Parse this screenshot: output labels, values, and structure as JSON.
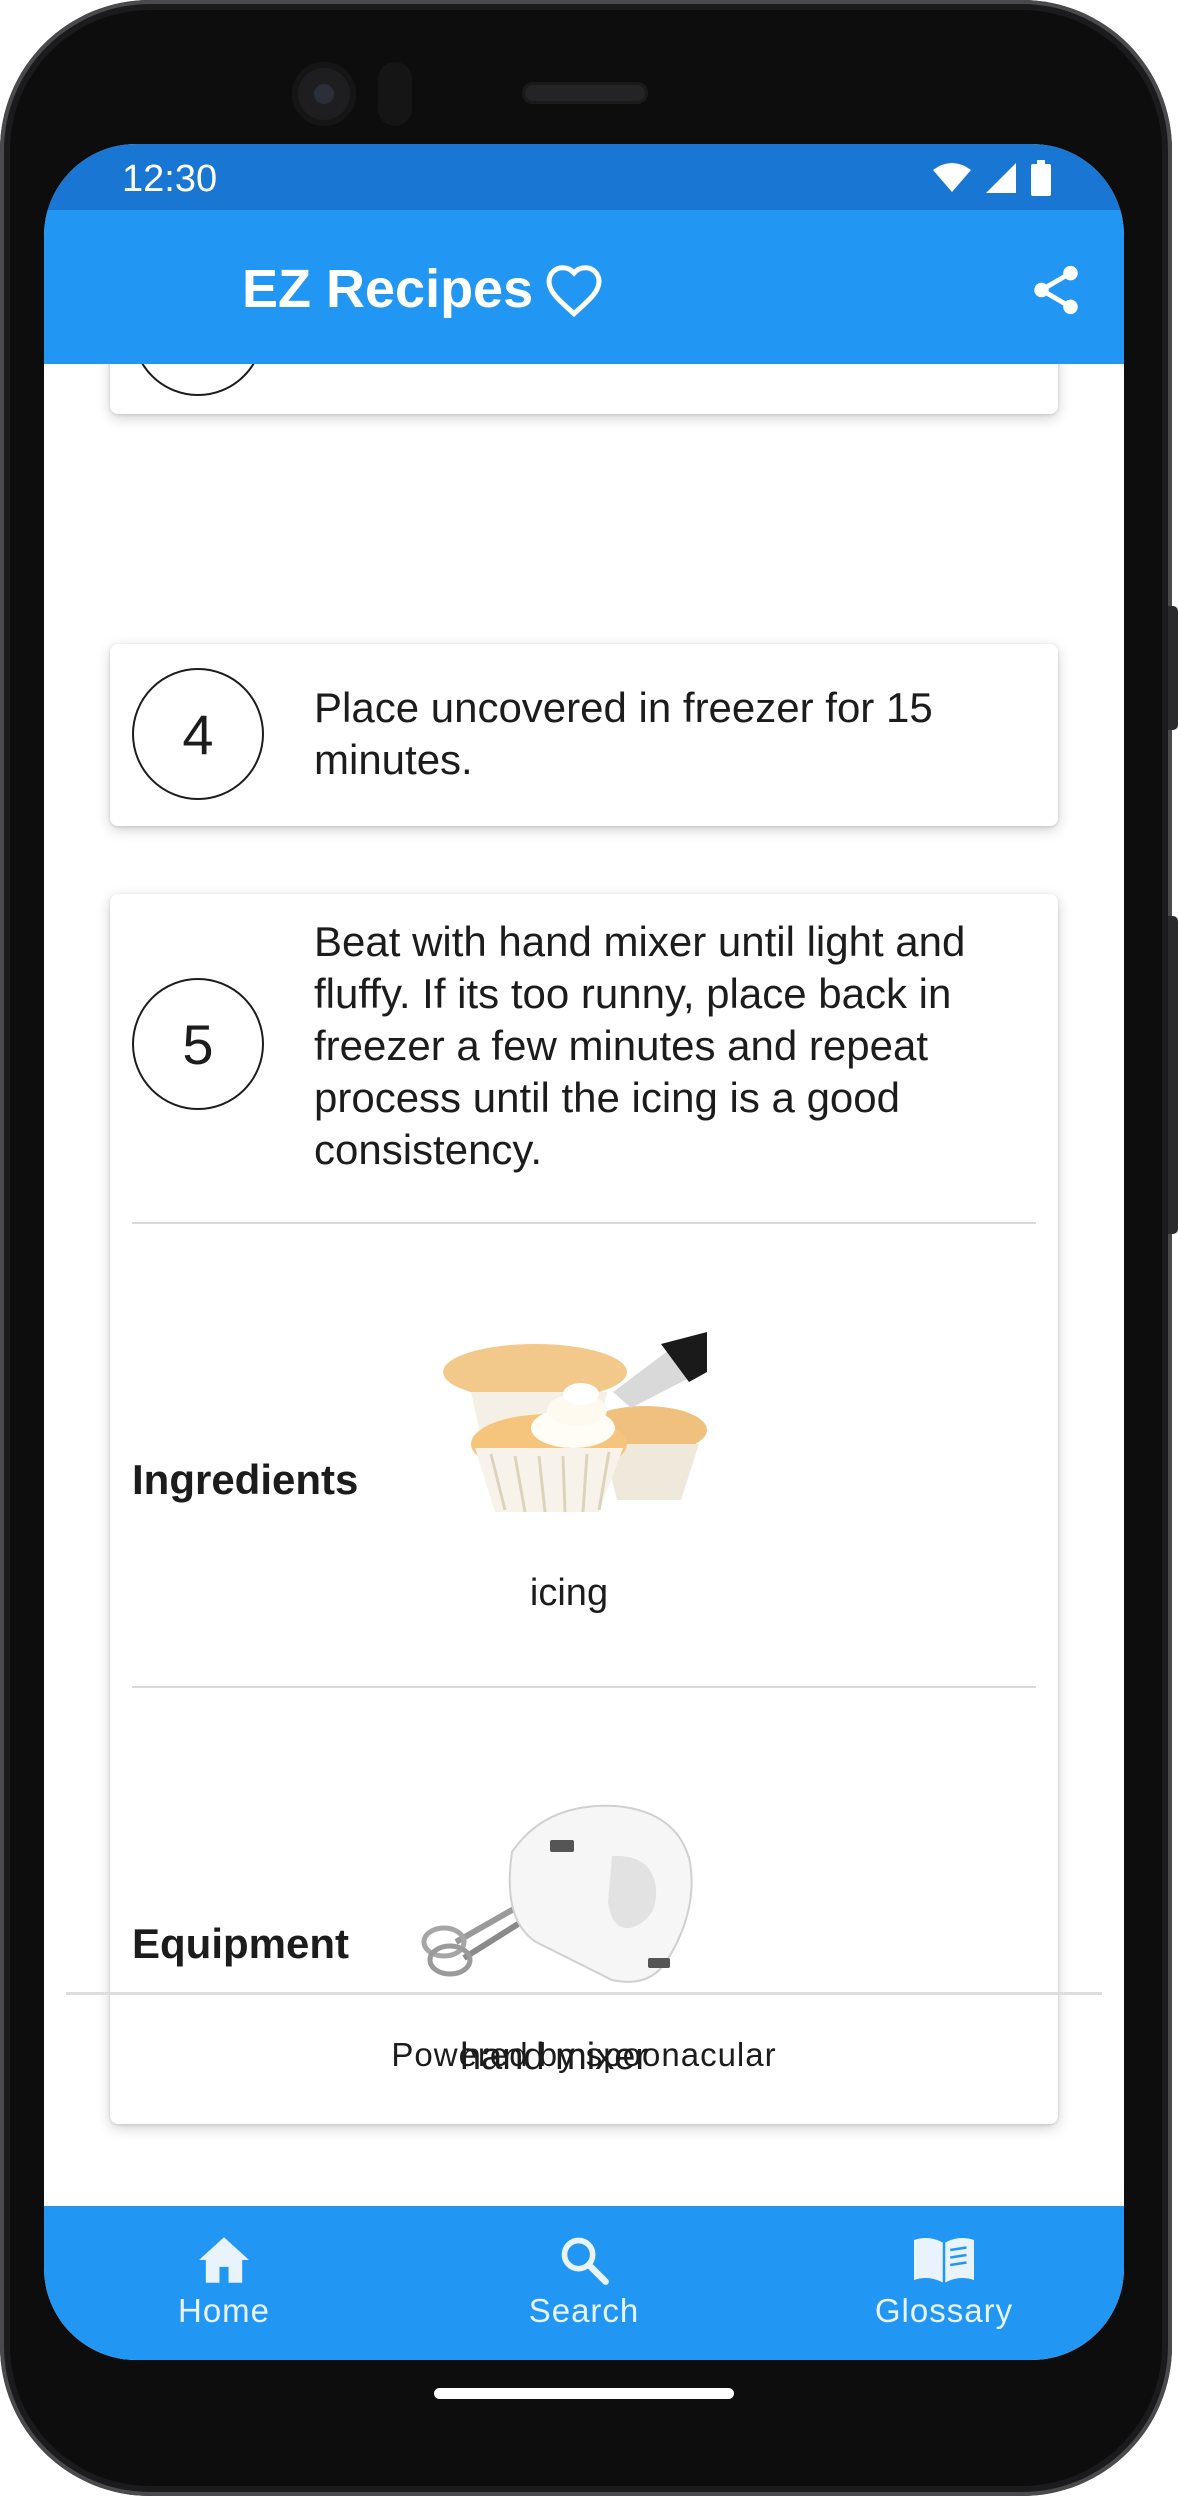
{
  "status_bar": {
    "time": "12:30"
  },
  "app_bar": {
    "title": "EZ Recipes",
    "favorite_icon": "heart-outline-icon",
    "share_icon": "share-icon"
  },
  "steps": [
    {
      "number": "4",
      "text": "Place uncovered in freezer for 15 minutes."
    },
    {
      "number": "5",
      "text": "Beat with hand mixer until light and fluffy. If its too runny, place back in freezer a few minutes and repeat process until the icing is a good consistency.",
      "ingredients_label": "Ingredients",
      "ingredients": [
        {
          "name": "icing"
        }
      ],
      "equipment_label": "Equipment",
      "equipment": [
        {
          "name": "hand mixer"
        }
      ]
    }
  ],
  "footer": {
    "powered_by": "Powered by spoonacular"
  },
  "bottom_nav": [
    {
      "label": "Home",
      "icon": "home-icon"
    },
    {
      "label": "Search",
      "icon": "search-icon"
    },
    {
      "label": "Glossary",
      "icon": "book-icon"
    }
  ],
  "colors": {
    "primary": "#2196f3",
    "status_bar": "#1976d2",
    "text": "#1c1c1c"
  }
}
